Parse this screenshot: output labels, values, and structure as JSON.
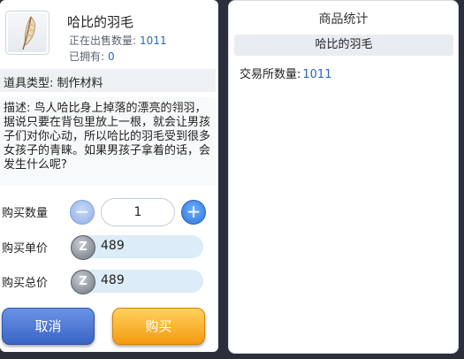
{
  "item": {
    "name": "哈比的羽毛",
    "on_sale_label": "正在出售数量:",
    "on_sale_count": "1011",
    "owned_label": "已拥有:",
    "owned_count": "0",
    "type_text": "道具类型: 制作材料",
    "icon": "feather-icon",
    "description": "描述: 鸟人哈比身上掉落的漂亮的翎羽，据说只要在背包里放上一根，就会让男孩子们对你心动，所以哈比的羽毛受到很多女孩子的青睐。如果男孩子拿着的话，会发生什么呢?"
  },
  "purchase": {
    "qty_label": "购买数量",
    "qty_value": "1",
    "unit_price_label": "购买单价",
    "unit_price": "489",
    "total_label": "购买总价",
    "total_price": "489",
    "currency_symbol": "Z",
    "cancel_label": "取消",
    "buy_label": "购买"
  },
  "stats": {
    "title": "商品统计",
    "item_name": "哈比的羽毛",
    "exchange_label": "交易所数量:",
    "exchange_count": "1011"
  },
  "colors": {
    "accent_blue": "#2b67b8",
    "buy_orange": "#f39a10",
    "cancel_blue": "#3a64c4"
  }
}
